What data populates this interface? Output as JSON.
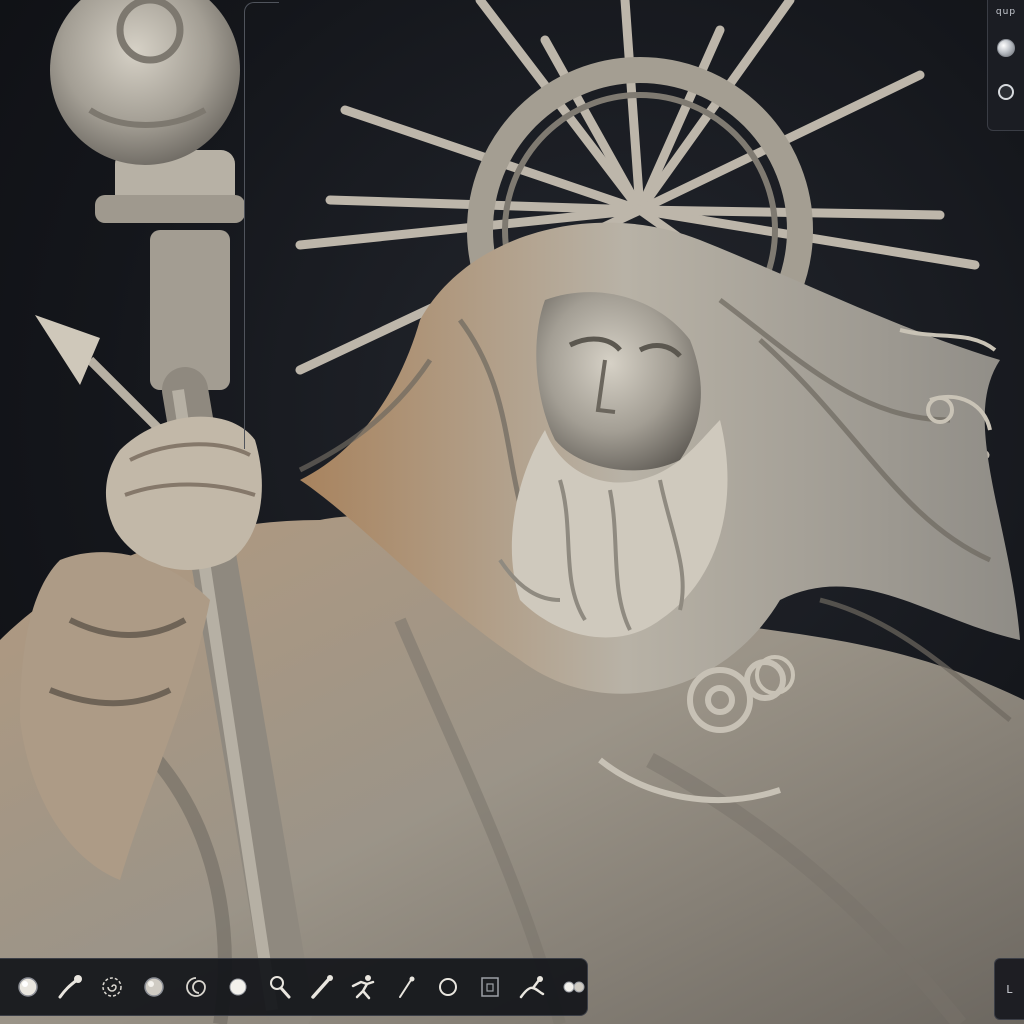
{
  "app": {
    "accent": "#e9e6df",
    "panel_bg": "#15171c"
  },
  "viewport": {
    "subject": "stone-sculpture",
    "material_color": "#a7a297"
  },
  "right_panel": {
    "label": "qup",
    "buttons": [
      {
        "icon": "sphere-icon"
      },
      {
        "icon": "ring-icon"
      }
    ]
  },
  "toolbar": {
    "tools": [
      {
        "icon": "sphere-brush-icon"
      },
      {
        "icon": "move-brush-icon"
      },
      {
        "icon": "spiral-brush-icon"
      },
      {
        "icon": "smooth-sphere-icon"
      },
      {
        "icon": "swirl-brush-icon"
      },
      {
        "icon": "inflate-sphere-icon"
      },
      {
        "icon": "magnify-brush-icon"
      },
      {
        "icon": "pen-brush-icon"
      },
      {
        "icon": "figure-pose-icon"
      },
      {
        "icon": "pin-brush-icon"
      },
      {
        "icon": "circle-outline-icon"
      },
      {
        "icon": "layer-square-icon"
      },
      {
        "icon": "snake-hook-icon"
      },
      {
        "icon": "double-sphere-icon"
      }
    ]
  },
  "corner_button": {
    "label": "L"
  }
}
